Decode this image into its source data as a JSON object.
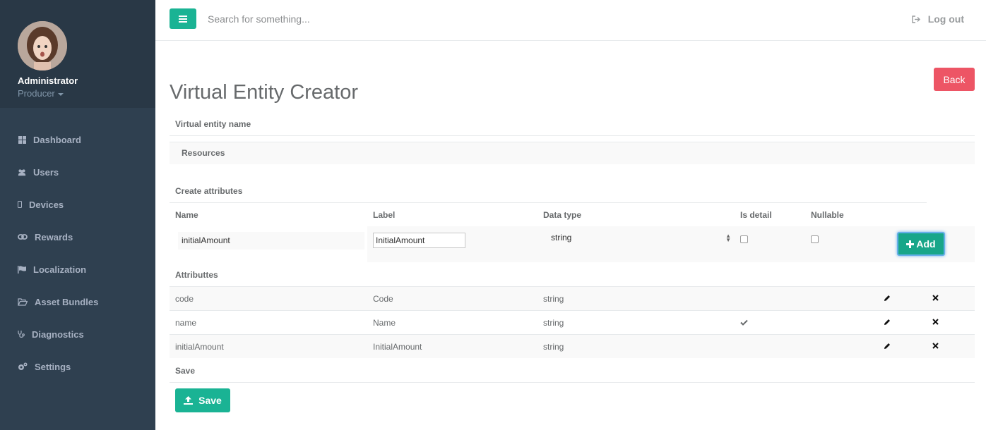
{
  "sidebar": {
    "profile_name": "Administrator",
    "profile_role": "Producer",
    "items": [
      {
        "label": "Dashboard",
        "icon": "th-large-icon"
      },
      {
        "label": "Users",
        "icon": "users-icon"
      },
      {
        "label": "Devices",
        "icon": "mobile-icon"
      },
      {
        "label": "Rewards",
        "icon": "link-icon"
      },
      {
        "label": "Localization",
        "icon": "flag-icon"
      },
      {
        "label": "Asset Bundles",
        "icon": "folder-open-icon"
      },
      {
        "label": "Diagnostics",
        "icon": "stethoscope-icon"
      },
      {
        "label": "Settings",
        "icon": "cogs-icon"
      }
    ]
  },
  "topbar": {
    "search_placeholder": "Search for something...",
    "logout_label": "Log out"
  },
  "page": {
    "title": "Virtual Entity Creator",
    "back_label": "Back",
    "entity_name_label": "Virtual entity name",
    "entity_name_value": "Resources",
    "create_attributes_label": "Create attributes",
    "columns": {
      "name": "Name",
      "label": "Label",
      "data_type": "Data type",
      "is_detail": "Is detail",
      "nullable": "Nullable"
    },
    "form": {
      "name_value": "initialAmount",
      "label_value": "InitialAmount",
      "data_type_value": "string",
      "is_detail_checked": false,
      "nullable_checked": false,
      "add_label": "Add"
    },
    "attributes_label": "Attributtes",
    "attributes": [
      {
        "name": "code",
        "label": "Code",
        "type": "string",
        "is_detail": false
      },
      {
        "name": "name",
        "label": "Name",
        "type": "string",
        "is_detail": true
      },
      {
        "name": "initialAmount",
        "label": "InitialAmount",
        "type": "string",
        "is_detail": false
      }
    ],
    "save_section_label": "Save",
    "save_label": "Save"
  },
  "colors": {
    "sidebar_bg": "#2f4050",
    "primary": "#1ab394",
    "danger": "#ed5565"
  }
}
